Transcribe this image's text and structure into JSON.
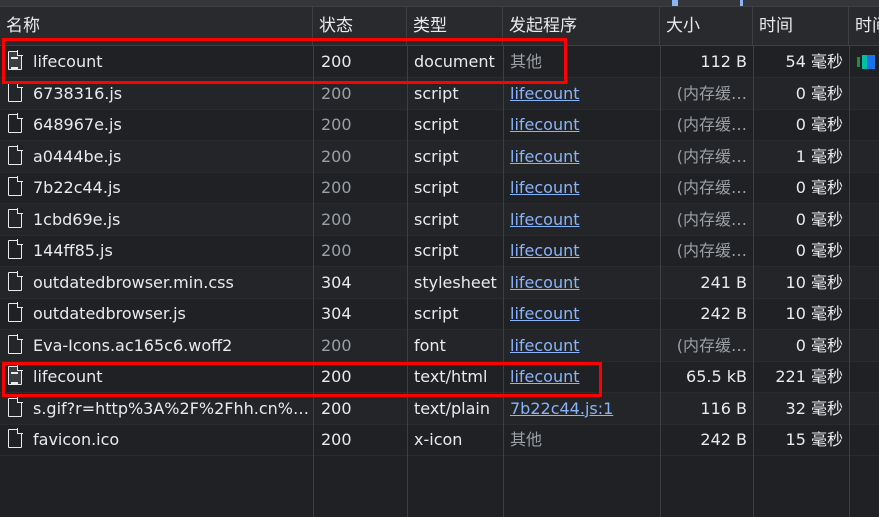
{
  "columns": {
    "name": "名称",
    "status": "状态",
    "type": "类型",
    "initiator": "发起程序",
    "size": "大小",
    "time": "时间",
    "waterfall": "时间"
  },
  "rows": [
    {
      "name": "lifecount",
      "icon": "document-icon",
      "status": "200",
      "type": "document",
      "initiator": "其他",
      "initiator_link": false,
      "size": "112 B",
      "time": "54 毫秒",
      "status_dim": false,
      "size_dim": false
    },
    {
      "name": "6738316.js",
      "icon": "file-icon",
      "status": "200",
      "type": "script",
      "initiator": "lifecount",
      "initiator_link": true,
      "size": "(内存缓…",
      "time": "0 毫秒",
      "status_dim": true,
      "size_dim": true
    },
    {
      "name": "648967e.js",
      "icon": "file-icon",
      "status": "200",
      "type": "script",
      "initiator": "lifecount",
      "initiator_link": true,
      "size": "(内存缓…",
      "time": "0 毫秒",
      "status_dim": true,
      "size_dim": true
    },
    {
      "name": "a0444be.js",
      "icon": "file-icon",
      "status": "200",
      "type": "script",
      "initiator": "lifecount",
      "initiator_link": true,
      "size": "(内存缓…",
      "time": "1 毫秒",
      "status_dim": true,
      "size_dim": true
    },
    {
      "name": "7b22c44.js",
      "icon": "file-icon",
      "status": "200",
      "type": "script",
      "initiator": "lifecount",
      "initiator_link": true,
      "size": "(内存缓…",
      "time": "0 毫秒",
      "status_dim": true,
      "size_dim": true
    },
    {
      "name": "1cbd69e.js",
      "icon": "file-icon",
      "status": "200",
      "type": "script",
      "initiator": "lifecount",
      "initiator_link": true,
      "size": "(内存缓…",
      "time": "0 毫秒",
      "status_dim": true,
      "size_dim": true
    },
    {
      "name": "144ff85.js",
      "icon": "file-icon",
      "status": "200",
      "type": "script",
      "initiator": "lifecount",
      "initiator_link": true,
      "size": "(内存缓…",
      "time": "0 毫秒",
      "status_dim": true,
      "size_dim": true
    },
    {
      "name": "outdatedbrowser.min.css",
      "icon": "file-icon",
      "status": "304",
      "type": "stylesheet",
      "initiator": "lifecount",
      "initiator_link": true,
      "size": "241 B",
      "time": "10 毫秒",
      "status_dim": false,
      "size_dim": false
    },
    {
      "name": "outdatedbrowser.js",
      "icon": "file-icon",
      "status": "304",
      "type": "script",
      "initiator": "lifecount",
      "initiator_link": true,
      "size": "242 B",
      "time": "10 毫秒",
      "status_dim": false,
      "size_dim": false
    },
    {
      "name": "Eva-Icons.ac165c6.woff2",
      "icon": "file-icon",
      "status": "200",
      "type": "font",
      "initiator": "lifecount",
      "initiator_link": true,
      "size": "(内存缓…",
      "time": "0 毫秒",
      "status_dim": true,
      "size_dim": true
    },
    {
      "name": "lifecount",
      "icon": "document-icon",
      "status": "200",
      "type": "text/html",
      "initiator": "lifecount",
      "initiator_link": true,
      "size": "65.5 kB",
      "time": "221 毫秒",
      "status_dim": false,
      "size_dim": false
    },
    {
      "name": "s.gif?r=http%3A%2F%2Fhh.cn%…",
      "icon": "file-icon",
      "status": "200",
      "type": "text/plain",
      "initiator": "7b22c44.js:1",
      "initiator_link": true,
      "size": "116 B",
      "time": "32 毫秒",
      "status_dim": false,
      "size_dim": false
    },
    {
      "name": "favicon.ico",
      "icon": "file-icon",
      "status": "200",
      "type": "x-icon",
      "initiator": "其他",
      "initiator_link": false,
      "size": "242 B",
      "time": "15 毫秒",
      "status_dim": false,
      "size_dim": false
    }
  ],
  "colors": {
    "background": "#202124",
    "header_bg": "#292a2d",
    "link": "#8ab4f8",
    "dim_text": "#9aa0a6",
    "highlight_box": "#ff0000",
    "waterfall_green": "#1e8e3e",
    "waterfall_blue": "#1a73e8"
  }
}
